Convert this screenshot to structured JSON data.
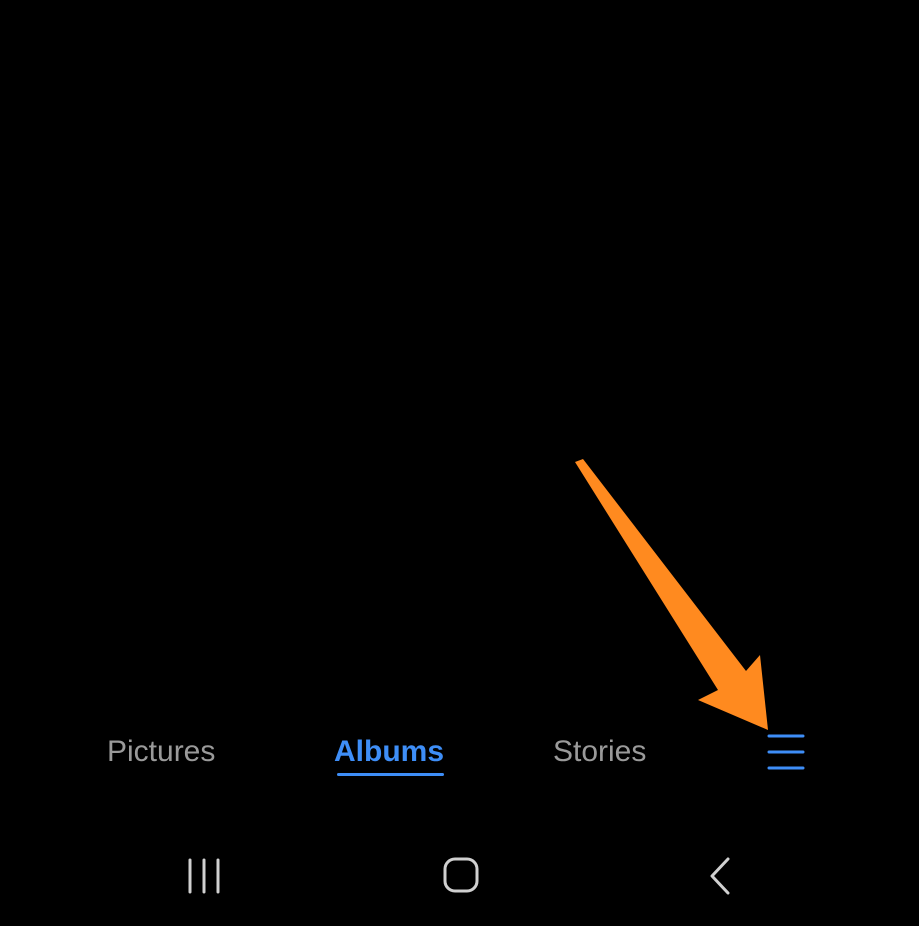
{
  "bottom_tabs": {
    "items": [
      {
        "label": "Pictures",
        "active": false
      },
      {
        "label": "Albums",
        "active": true
      },
      {
        "label": "Stories",
        "active": false
      }
    ],
    "menu_icon": "hamburger-menu-icon"
  },
  "nav_bar": {
    "recents_icon": "recents-icon",
    "home_icon": "home-icon",
    "back_icon": "back-icon"
  },
  "colors": {
    "background": "#000000",
    "accent": "#3e8ef7",
    "inactive_text": "#9a9a9a",
    "nav_icon": "#d0d0d0",
    "annotation_arrow": "#ff8a1f"
  }
}
